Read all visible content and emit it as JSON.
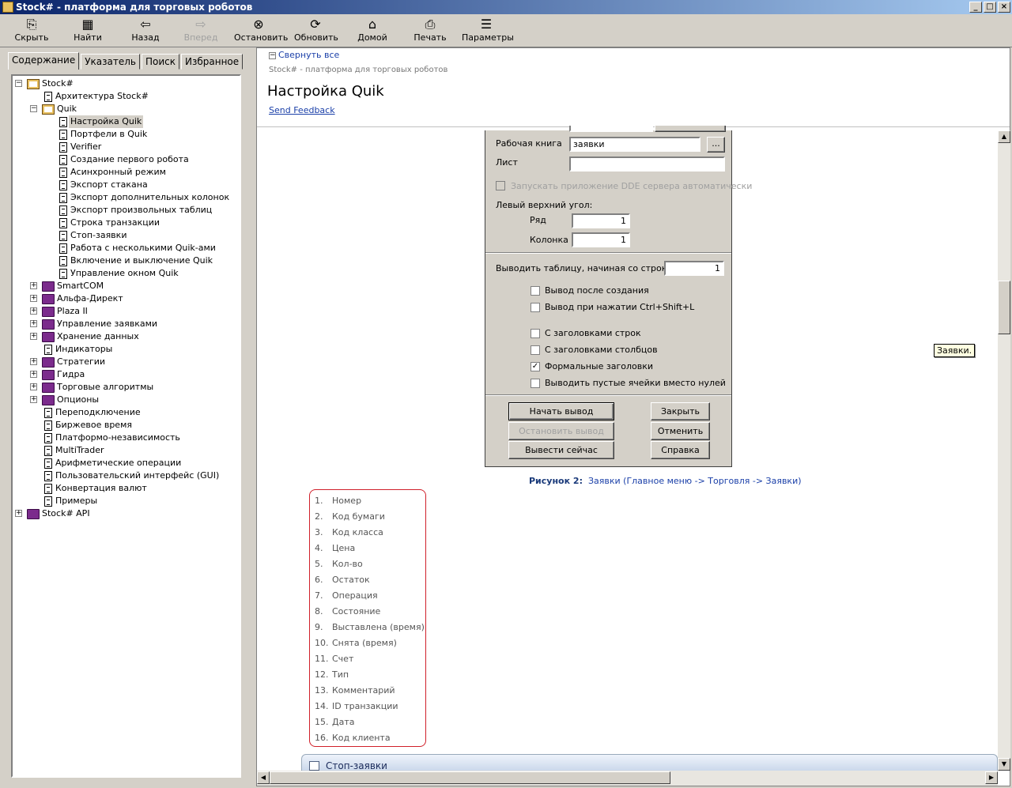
{
  "window": {
    "title": "Stock# - платформа для торговых роботов",
    "controls": [
      "_",
      "□",
      "×"
    ]
  },
  "toolbar": [
    {
      "label": "Скрыть",
      "icon": "hide-icon",
      "glyph": "⎘",
      "enabled": true
    },
    {
      "label": "Найти",
      "icon": "find-icon",
      "glyph": "▦",
      "enabled": true
    },
    {
      "label": "Назад",
      "icon": "back-arrow-icon",
      "glyph": "⇦",
      "enabled": true
    },
    {
      "label": "Вперед",
      "icon": "forward-arrow-icon",
      "glyph": "⇨",
      "enabled": false
    },
    {
      "label": "Остановить",
      "icon": "stop-icon",
      "glyph": "⊗",
      "enabled": true
    },
    {
      "label": "Обновить",
      "icon": "refresh-icon",
      "glyph": "⟳",
      "enabled": true
    },
    {
      "label": "Домой",
      "icon": "home-icon",
      "glyph": "⌂",
      "enabled": true
    },
    {
      "label": "Печать",
      "icon": "print-icon",
      "glyph": "⎙",
      "enabled": true
    },
    {
      "label": "Параметры",
      "icon": "options-icon",
      "glyph": "☰",
      "enabled": true
    }
  ],
  "nav_tabs": [
    "Содержание",
    "Указатель",
    "Поиск",
    "Избранное"
  ],
  "tree": [
    {
      "label": "Stock#",
      "level": 0,
      "type": "book-open",
      "expander": "−"
    },
    {
      "label": "Архитектура Stock#",
      "level": 1,
      "type": "page"
    },
    {
      "label": "Quik",
      "level": 1,
      "type": "book-open",
      "expander": "−"
    },
    {
      "label": "Настройка Quik",
      "level": 2,
      "type": "page",
      "selected": true
    },
    {
      "label": "Портфели в Quik",
      "level": 2,
      "type": "page"
    },
    {
      "label": "Verifier",
      "level": 2,
      "type": "page"
    },
    {
      "label": "Создание первого робота",
      "level": 2,
      "type": "page"
    },
    {
      "label": "Асинхронный режим",
      "level": 2,
      "type": "page"
    },
    {
      "label": "Экспорт стакана",
      "level": 2,
      "type": "page"
    },
    {
      "label": "Экспорт дополнительных колонок",
      "level": 2,
      "type": "page"
    },
    {
      "label": "Экспорт произвольных таблиц",
      "level": 2,
      "type": "page"
    },
    {
      "label": "Строка транзакции",
      "level": 2,
      "type": "page"
    },
    {
      "label": "Стоп-заявки",
      "level": 2,
      "type": "page"
    },
    {
      "label": "Работа с несколькими Quik-ами",
      "level": 2,
      "type": "page"
    },
    {
      "label": "Включение и выключение Quik",
      "level": 2,
      "type": "page"
    },
    {
      "label": "Управление окном Quik",
      "level": 2,
      "type": "page"
    },
    {
      "label": "SmartCOM",
      "level": 1,
      "type": "book",
      "expander": "+"
    },
    {
      "label": "Альфа-Директ",
      "level": 1,
      "type": "book",
      "expander": "+"
    },
    {
      "label": "Plaza II",
      "level": 1,
      "type": "book",
      "expander": "+"
    },
    {
      "label": "Управление заявками",
      "level": 1,
      "type": "book",
      "expander": "+"
    },
    {
      "label": "Хранение данных",
      "level": 1,
      "type": "book",
      "expander": "+"
    },
    {
      "label": "Индикаторы",
      "level": 1,
      "type": "page"
    },
    {
      "label": "Стратегии",
      "level": 1,
      "type": "book",
      "expander": "+"
    },
    {
      "label": "Гидра",
      "level": 1,
      "type": "book",
      "expander": "+"
    },
    {
      "label": "Торговые алгоритмы",
      "level": 1,
      "type": "book",
      "expander": "+"
    },
    {
      "label": "Опционы",
      "level": 1,
      "type": "book",
      "expander": "+"
    },
    {
      "label": "Переподключение",
      "level": 1,
      "type": "page"
    },
    {
      "label": "Биржевое время",
      "level": 1,
      "type": "page"
    },
    {
      "label": "Платформо-независимость",
      "level": 1,
      "type": "page"
    },
    {
      "label": "MultiTrader",
      "level": 1,
      "type": "page"
    },
    {
      "label": "Арифметические операции",
      "level": 1,
      "type": "page"
    },
    {
      "label": "Пользовательский интерфейс (GUI)",
      "level": 1,
      "type": "page"
    },
    {
      "label": "Конвертация валют",
      "level": 1,
      "type": "page"
    },
    {
      "label": "Примеры",
      "level": 1,
      "type": "page"
    },
    {
      "label": "Stock# API",
      "level": 0,
      "type": "book",
      "expander": "+"
    }
  ],
  "header": {
    "collapse_all": "Свернуть все",
    "breadcrumb": "Stock# - платформа для торговых роботов",
    "title": "Настройка Quik",
    "feedback": "Send Feedback"
  },
  "dialog": {
    "workbook_label": "Рабочая книга",
    "workbook_value": "заявки",
    "browse_label": "...",
    "sheet_label": "Лист",
    "sheet_value": "",
    "autostart_label": "Запускать приложение DDE сервера автоматически",
    "corner_label": "Левый верхний угол:",
    "row_label": "Ряд",
    "row_value": "1",
    "col_label": "Колонка",
    "col_value": "1",
    "start_row_label": "Выводить таблицу,  начиная со строки",
    "start_row_value": "1",
    "checkboxes": [
      {
        "label": "Вывод после создания",
        "checked": false
      },
      {
        "label": "Вывод при нажатии Ctrl+Shift+L",
        "checked": false
      },
      {
        "label": "С заголовками строк",
        "checked": false
      },
      {
        "label": "С заголовками столбцов",
        "checked": false
      },
      {
        "label": "Формальные заголовки",
        "checked": true
      },
      {
        "label": "Выводить пустые ячейки вместо нулей",
        "checked": false
      }
    ],
    "buttons": {
      "start": "Начать вывод",
      "stop": "Остановить вывод",
      "now": "Вывести сейчас",
      "close": "Закрыть",
      "cancel": "Отменить",
      "help": "Справка"
    }
  },
  "figure_caption": {
    "label": "Рисунок 2:",
    "text": "Заявки (Главное меню -> Торговля -> Заявки)"
  },
  "columns_list": [
    {
      "n": "1.",
      "text": "Номер"
    },
    {
      "n": "2.",
      "text": "Код бумаги"
    },
    {
      "n": "3.",
      "text": "Код класса"
    },
    {
      "n": "4.",
      "text": "Цена"
    },
    {
      "n": "5.",
      "text": "Кол-во"
    },
    {
      "n": "6.",
      "text": "Остаток"
    },
    {
      "n": "7.",
      "text": "Операция"
    },
    {
      "n": "8.",
      "text": "Состояние"
    },
    {
      "n": "9.",
      "text": "Выставлена (время)"
    },
    {
      "n": "10.",
      "text": "Снята (время)"
    },
    {
      "n": "11.",
      "text": "Счет"
    },
    {
      "n": "12.",
      "text": "Тип"
    },
    {
      "n": "13.",
      "text": "Комментарий"
    },
    {
      "n": "14.",
      "text": "ID транзакции"
    },
    {
      "n": "15.",
      "text": "Дата"
    },
    {
      "n": "16.",
      "text": "Код клиента"
    }
  ],
  "tooltip": "Заявки.",
  "next_section": "Стоп-заявки",
  "colors": {
    "link": "#1a3fa8",
    "list_border": "#d0202a",
    "title_bar": "#0a246a"
  }
}
